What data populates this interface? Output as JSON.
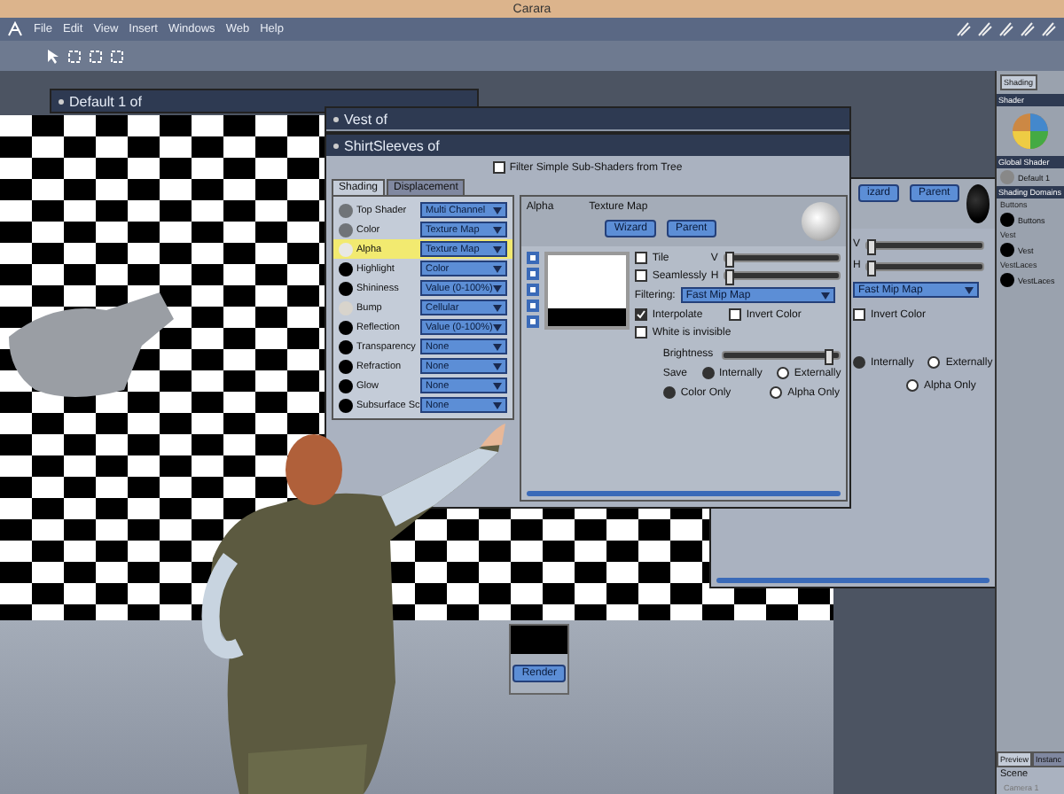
{
  "window": {
    "title": "Carara"
  },
  "menu": [
    "File",
    "Edit",
    "View",
    "Insert",
    "Windows",
    "Web",
    "Help"
  ],
  "viewport": {
    "title": "Default 1 of"
  },
  "vest_window": {
    "title": "Vest of"
  },
  "shader_window": {
    "title": "ShirtSleeves of",
    "filter": {
      "label": "Filter Simple Sub-Shaders from Tree",
      "checked": false
    },
    "tabs": [
      {
        "label": "Shading",
        "selected": true
      },
      {
        "label": "Displacement",
        "selected": false
      }
    ],
    "channels": [
      {
        "name": "Top Shader",
        "value": "Multi Channel",
        "color": "#707478",
        "selected": false
      },
      {
        "name": "Color",
        "value": "Texture Map",
        "color": "#707478",
        "selected": false
      },
      {
        "name": "Alpha",
        "value": "Texture Map",
        "color": "#e8e8e4",
        "selected": true
      },
      {
        "name": "Highlight",
        "value": "Color",
        "color": "#000000",
        "selected": false
      },
      {
        "name": "Shininess",
        "value": "Value (0-100%)",
        "color": "#000000",
        "selected": false
      },
      {
        "name": "Bump",
        "value": "Cellular",
        "color": "#d8d4cc",
        "selected": false
      },
      {
        "name": "Reflection",
        "value": "Value (0-100%)",
        "color": "#000000",
        "selected": false
      },
      {
        "name": "Transparency",
        "value": "None",
        "color": "#000000",
        "selected": false
      },
      {
        "name": "Refraction",
        "value": "None",
        "color": "#000000",
        "selected": false
      },
      {
        "name": "Glow",
        "value": "None",
        "color": "#000000",
        "selected": false
      },
      {
        "name": "Subsurface Sc",
        "value": "None",
        "color": "#000000",
        "selected": false
      }
    ],
    "editor": {
      "channel": "Alpha",
      "type": "Texture Map",
      "buttons": [
        "Wizard",
        "Parent"
      ],
      "tile": {
        "label": "Tile",
        "checked": false,
        "axis": "V",
        "level": 0
      },
      "seamless": {
        "label": "Seamlessly",
        "checked": false,
        "axis": "H",
        "level": 0
      },
      "filtering": {
        "label": "Filtering:",
        "value": "Fast Mip Map"
      },
      "interpolate": {
        "label": "Interpolate",
        "checked": true
      },
      "invert": {
        "label": "Invert Color",
        "checked": false
      },
      "white_invisible": {
        "label": "White is invisible",
        "checked": false
      },
      "brightness": {
        "label": "Brightness",
        "level": 0.95
      },
      "save": {
        "label": "Save",
        "options": [
          {
            "label": "Internally",
            "selected": true
          },
          {
            "label": "Externally",
            "selected": false
          }
        ]
      },
      "mode": [
        {
          "label": "Color Only",
          "selected": true
        },
        {
          "label": "Alpha Only",
          "selected": false
        }
      ]
    }
  },
  "back_window": {
    "buttons": [
      "izard",
      "Parent"
    ],
    "sliders": [
      {
        "axis": "V",
        "level": 0
      },
      {
        "axis": "H",
        "level": 0
      }
    ],
    "filtering": "Fast Mip Map",
    "invert": {
      "label": "Invert Color",
      "checked": false
    },
    "save": [
      {
        "label": "Internally",
        "selected": true
      },
      {
        "label": "Externally",
        "selected": false
      }
    ],
    "mode": {
      "label": "Alpha Only",
      "selected": false
    }
  },
  "render": {
    "button": "Render"
  },
  "side_panel": {
    "tab": "Shading",
    "shader_header": "Shader",
    "global_header": "Global Shader",
    "global_item": "Default 1",
    "domains_header": "Shading Domains",
    "domains": [
      {
        "label": "Buttons",
        "item": "Buttons"
      },
      {
        "label": "Vest",
        "item": "Vest"
      },
      {
        "label": "VestLaces",
        "item": "VestLaces"
      }
    ],
    "bottom_tabs": [
      {
        "label": "Preview",
        "selected": true
      },
      {
        "label": "Instanc",
        "selected": false
      }
    ],
    "scene": "Scene",
    "camera": "Camera 1"
  }
}
